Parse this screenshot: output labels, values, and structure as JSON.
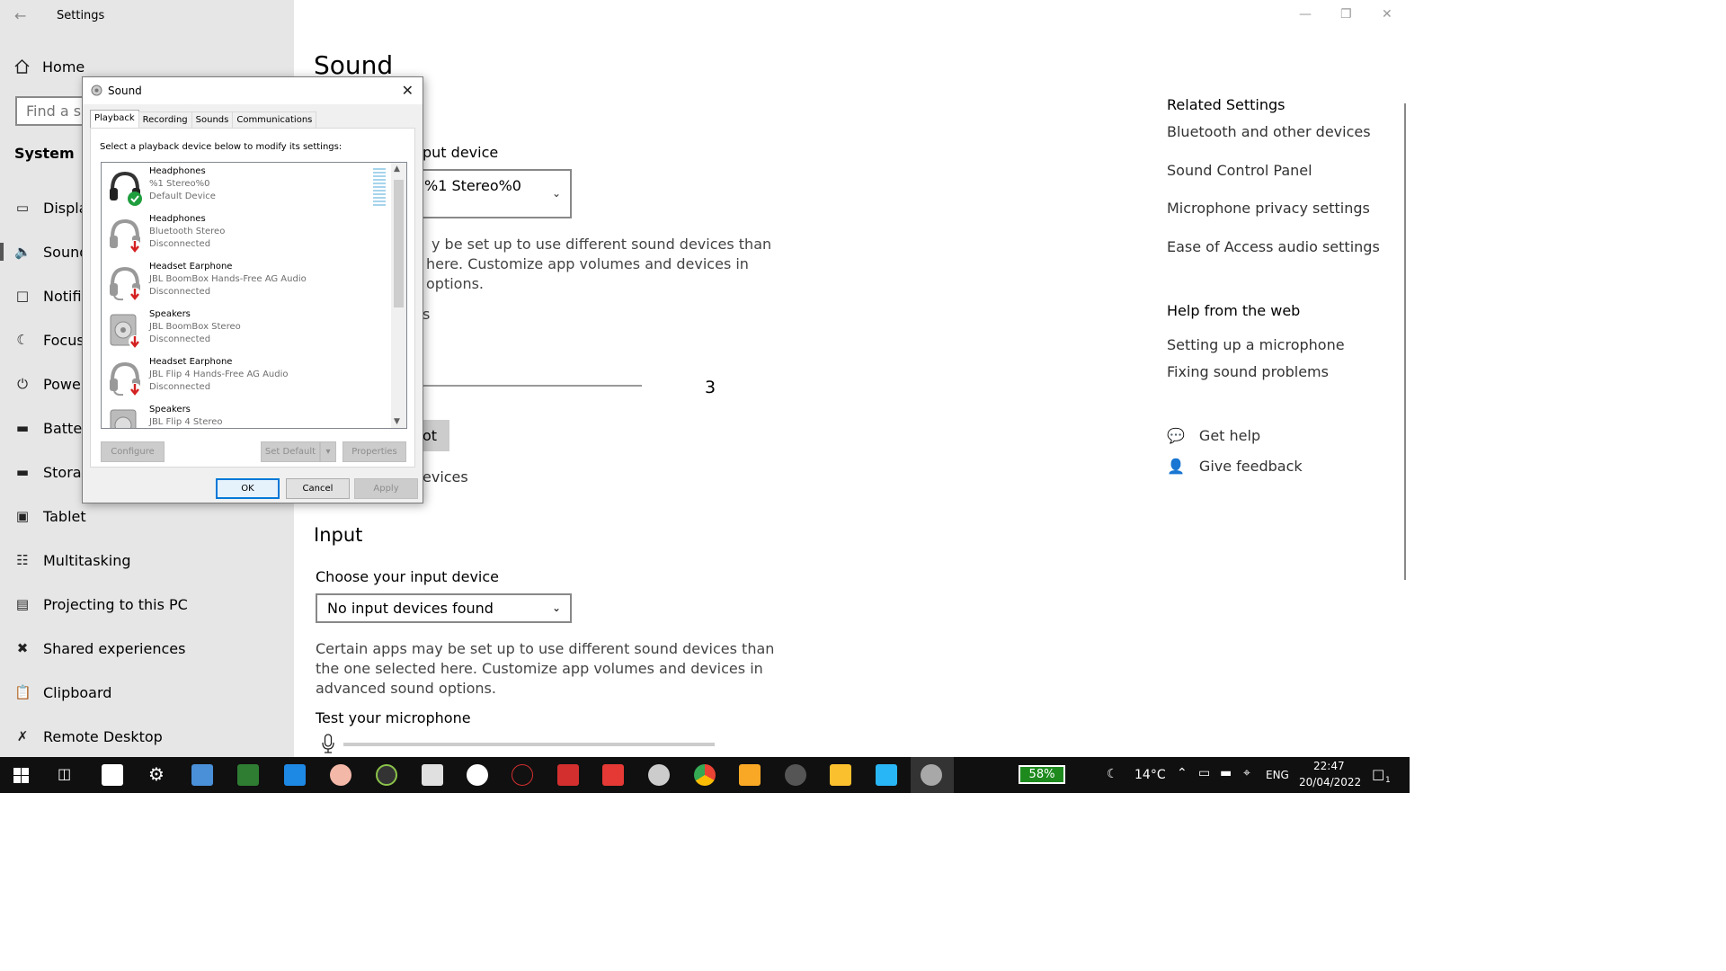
{
  "window": {
    "title": "Settings",
    "minimize_icon": "minimize-icon",
    "restore_icon": "restore-icon",
    "close_icon": "close-icon"
  },
  "sidebar": {
    "home_label": "Home",
    "search_placeholder": "Find a se",
    "section_label": "System",
    "items": [
      {
        "label": "Displa",
        "icon": "display-icon"
      },
      {
        "label": "Sound",
        "icon": "speaker-icon"
      },
      {
        "label": "Notific",
        "icon": "notification-icon"
      },
      {
        "label": "Focus",
        "icon": "moon-icon"
      },
      {
        "label": "Power",
        "icon": "power-icon"
      },
      {
        "label": "Batter",
        "icon": "battery-icon"
      },
      {
        "label": "Storag",
        "icon": "storage-icon"
      },
      {
        "label": "Tablet",
        "icon": "tablet-icon"
      },
      {
        "label": "Multitasking",
        "icon": "multitasking-icon"
      },
      {
        "label": "Projecting to this PC",
        "icon": "projecting-icon"
      },
      {
        "label": "Shared experiences",
        "icon": "shared-icon"
      },
      {
        "label": "Clipboard",
        "icon": "clipboard-icon"
      },
      {
        "label": "Remote Desktop",
        "icon": "remote-desktop-icon"
      }
    ]
  },
  "main": {
    "page_title": "Sound",
    "output": {
      "choose_label_partial": "put device",
      "selected_partial": "%1 Stereo%0",
      "desc_lines": [
        "y be set up to use different sound devices than",
        "here. Customize app volumes and devices in",
        "options."
      ],
      "props_partial": "s",
      "volume_value": "3",
      "troubleshoot_partial": "ot",
      "manage_partial": "evices"
    },
    "input": {
      "section_title": "Input",
      "choose_label": "Choose your input device",
      "selected": "No input devices found",
      "desc_lines": [
        "Certain apps may be set up to use different sound devices than",
        "the one selected here. Customize app volumes and devices in",
        "advanced sound options."
      ],
      "test_label": "Test your microphone"
    }
  },
  "related": {
    "heading": "Related Settings",
    "links": [
      "Bluetooth and other devices",
      "Sound Control Panel",
      "Microphone privacy settings",
      "Ease of Access audio settings"
    ],
    "help_heading": "Help from the web",
    "help_links": [
      "Setting up a microphone",
      "Fixing sound problems"
    ],
    "get_help": "Get help",
    "give_feedback": "Give feedback"
  },
  "dialog": {
    "title": "Sound",
    "tabs": [
      "Playback",
      "Recording",
      "Sounds",
      "Communications"
    ],
    "instruction": "Select a playback device below to modify its settings:",
    "devices": [
      {
        "name": "Headphones",
        "desc": "%1 Stereo%0",
        "status": "Default Device",
        "icon": "headphones-icon"
      },
      {
        "name": "Headphones",
        "desc": "Bluetooth Stereo",
        "status": "Disconnected",
        "icon": "headphones-icon"
      },
      {
        "name": "Headset Earphone",
        "desc": "JBL BoomBox Hands-Free AG Audio",
        "status": "Disconnected",
        "icon": "headset-icon"
      },
      {
        "name": "Speakers",
        "desc": "JBL BoomBox Stereo",
        "status": "Disconnected",
        "icon": "speaker-device-icon"
      },
      {
        "name": "Headset Earphone",
        "desc": "JBL Flip 4 Hands-Free AG Audio",
        "status": "Disconnected",
        "icon": "headset-icon"
      },
      {
        "name": "Speakers",
        "desc": "JBL Flip 4 Stereo",
        "status": "",
        "icon": "speaker-device-icon"
      }
    ],
    "buttons": {
      "configure": "Configure",
      "set_default": "Set Default",
      "properties": "Properties",
      "ok": "OK",
      "cancel": "Cancel",
      "apply": "Apply"
    }
  },
  "taskbar": {
    "battery": "58%",
    "temperature": "14°C",
    "language": "ENG",
    "time": "22:47",
    "date": "20/04/2022",
    "notification_count": "1"
  }
}
